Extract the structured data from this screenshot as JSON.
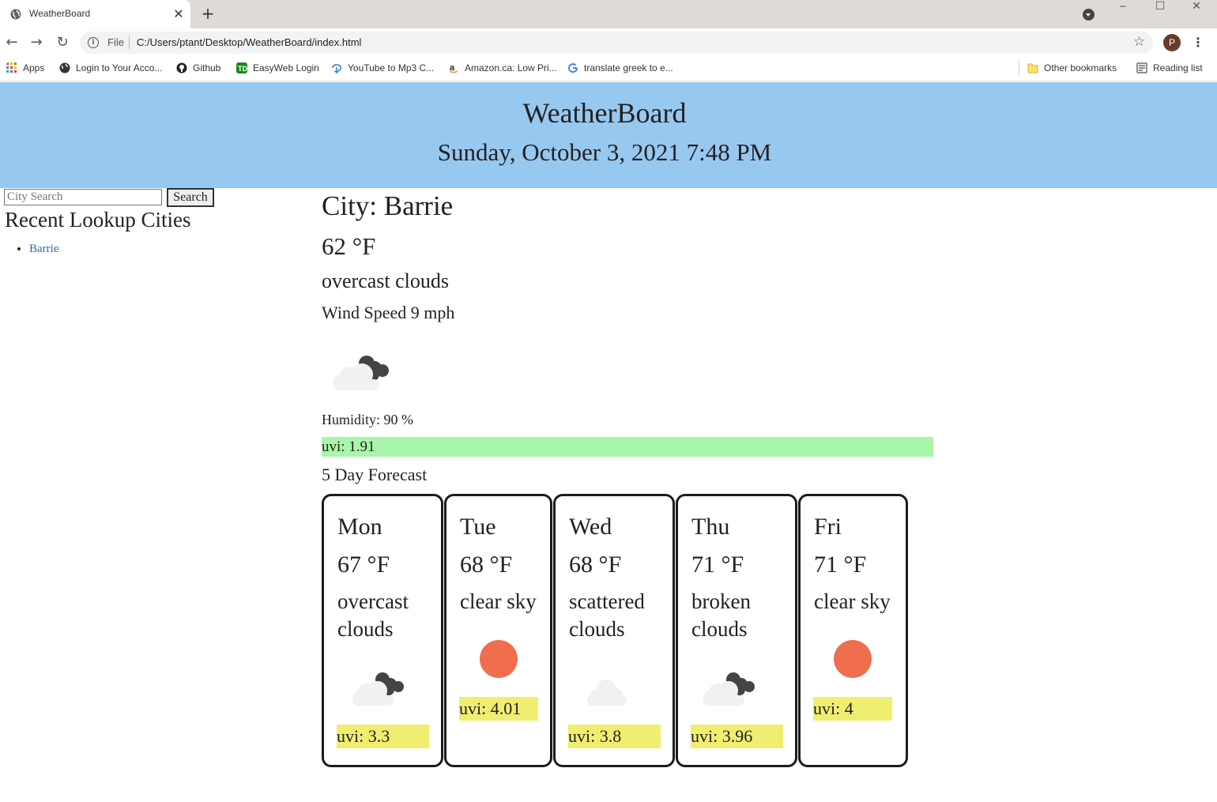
{
  "browser": {
    "tab_title": "WeatherBoard",
    "tab_close": "✕",
    "new_tab": "+",
    "url_scheme_label": "File",
    "url": "C:/Users/ptant/Desktop/WeatherBoard/index.html",
    "profile_initial": "P",
    "window_buttons": {
      "minimize": "‒",
      "maximize": "☐",
      "close": "✕"
    },
    "bookmarks": [
      {
        "label": "Apps",
        "icon": "apps-grid-icon"
      },
      {
        "label": "Login to Your Acco...",
        "icon": "globe-icon"
      },
      {
        "label": "Github",
        "icon": "github-icon"
      },
      {
        "label": "EasyWeb Login",
        "icon": "td-icon"
      },
      {
        "label": "YouTube to Mp3 C...",
        "icon": "download-icon"
      },
      {
        "label": "Amazon.ca: Low Pri...",
        "icon": "amazon-icon"
      },
      {
        "label": "translate greek to e...",
        "icon": "google-icon"
      }
    ],
    "other_bookmarks": "Other bookmarks",
    "reading_list": "Reading list"
  },
  "header": {
    "title": "WeatherBoard",
    "date": "Sunday, October 3, 2021 7:48 PM",
    "bg_color": "#97c8f0"
  },
  "sidebar": {
    "search_placeholder": "City Search",
    "search_button": "Search",
    "recent_title": "Recent Lookup Cities",
    "recent_cities": [
      "Barrie"
    ]
  },
  "current": {
    "city": "City: Barrie",
    "temp": "62 °F",
    "description": "overcast clouds",
    "wind": "Wind Speed 9 mph",
    "icon": "overcast-clouds-icon",
    "humidity": "Humidity: 90 %",
    "uvi": "uvi: 1.91",
    "uvi_color": "#a9f5a9"
  },
  "forecast": {
    "title": "5 Day Forecast",
    "uvi_color": "#f0ee70",
    "days": [
      {
        "day": "Mon",
        "temp": "67 °F",
        "description": "overcast clouds",
        "icon": "overcast-clouds-icon",
        "uvi": "uvi: 3.3"
      },
      {
        "day": "Tue",
        "temp": "68 °F",
        "description": "clear sky",
        "icon": "sun-icon",
        "uvi": "uvi: 4.01"
      },
      {
        "day": "Wed",
        "temp": "68 °F",
        "description": "scattered clouds",
        "icon": "scattered-clouds-icon",
        "uvi": "uvi: 3.8"
      },
      {
        "day": "Thu",
        "temp": "71 °F",
        "description": "broken clouds",
        "icon": "broken-clouds-icon",
        "uvi": "uvi: 3.96"
      },
      {
        "day": "Fri",
        "temp": "71 °F",
        "description": "clear sky",
        "icon": "sun-icon",
        "uvi": "uvi: 4"
      }
    ]
  }
}
